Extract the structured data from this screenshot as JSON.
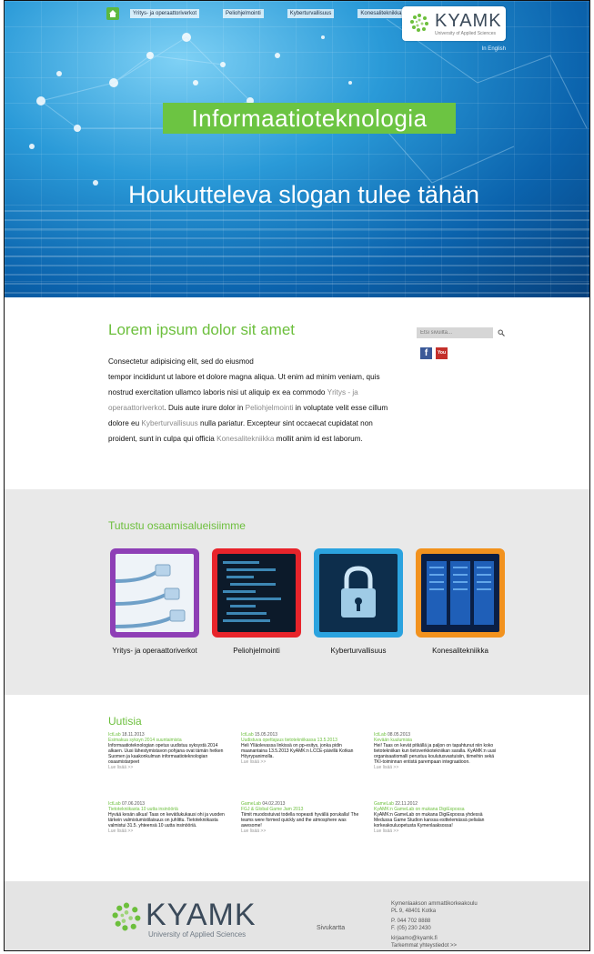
{
  "nav": {
    "home_icon": "home-icon",
    "items": [
      "Yritys- ja operaattoriverkot",
      "Peliohjelmointi",
      "Kyberturvallisuus",
      "Konesaliteknikka"
    ]
  },
  "logo": {
    "name": "KYAMK",
    "subtitle": "University of Applied Sciences"
  },
  "hero": {
    "in_english": "In English",
    "banner": "Informaatioteknologia",
    "slogan": "Houkutteleva slogan tulee tähän"
  },
  "intro": {
    "title": "Lorem ipsum dolor sit amet",
    "p1": "Consectetur adipisicing elit, sed do eiusmod",
    "p2": "tempor incididunt ut labore et dolore magna aliqua. Ut enim ad minim veniam, quis nostrud exercitation ullamco laboris nisi ut aliquip ex ea commodo ",
    "link1": "Yritys - ja operaattoriverkot",
    "p3": ". Duis aute irure dolor in ",
    "link2": "Peliohjelmointi",
    "p4": " in voluptate velit esse cillum dolore eu ",
    "link3": "Kyberturvallisuus",
    "p5": " nulla pariatur. Excepteur sint occaecat cupidatat non proident, sunt in culpa qui officia ",
    "link4": "Konesalitekniikka",
    "p6": " mollit anim id est laborum."
  },
  "sidebar": {
    "search_placeholder": "Etsi sivuilta...",
    "facebook": "f",
    "youtube": "You Tube"
  },
  "areas": {
    "title": "Tutustu osaamisalueisiimme",
    "tiles": [
      {
        "label": "Yritys- ja operaattoriverkot",
        "color": "#8e3fb6"
      },
      {
        "label": "Peliohjelmointi",
        "color": "#e8242b"
      },
      {
        "label": "Kyberturvallisuus",
        "color": "#2ba3df"
      },
      {
        "label": "Konesalitekniikka",
        "color": "#f2921e"
      }
    ]
  },
  "news": {
    "title": "Uutisia",
    "more": "Lue lisää >>",
    "items": [
      {
        "source": "IctLab",
        "date": "18.11.2013",
        "headline": "Esimakua syksyn 2014 suuntaimista",
        "body": "Informaatioteknologian opetus uudistuu syksystä 2014 alkaen. Uusi lähestymistavon pohjana ovat tämän hetken Suomen ja kaakonkulman informaatioteknologian osaamistarpeet"
      },
      {
        "source": "IctLab",
        "date": "15.05.2013",
        "headline": "Uudistuva opettajuus tietotekniikassa 13.5.2013",
        "body": "Heli Ylläolevassa linkissä on pp-esitys, jonka pidin maanantaina 13.5.2013 KyAMK:n LCCE-päivillä Kotkan Höyrypanimolla."
      },
      {
        "source": "IctLab",
        "date": "08.05.2013",
        "headline": "Kevään kuulumisia",
        "body": "Hei! Taas on kevät pitkällä ja paljon on tapahtunut niin koko tietotekniikan kun tietoverkkotekniikan saralla. KyAMK:n uusi organisaatiomalli perustuu koulutusvastuisiin, tiimeihin sekä TKI-toiminnan entistä parempaan integraatioon."
      },
      {
        "source": "IctLab",
        "date": "07.06.2013",
        "headline": "Tietotekniikasta 10 uutta insinööriä",
        "body": "Hyvää kesän alkua! Taas on kevätlukukausi ohi ja vuoden tärkein valmistumistilaisuus on juhlittu. Tietotekniikasta valmistui 31.5. yhteensä 10 uutta insinööriä."
      },
      {
        "source": "GameLab",
        "date": "04.02.2013",
        "headline": "FGJ & Global Game Jam 2013",
        "body": "Tiimit muodostuivat todella nopeasti hyvällä porukalla! The teams were formed quickly and the atmosphere was awesome!"
      },
      {
        "source": "GameLab",
        "date": "22.11.2012",
        "headline": "KyAMK:n GameLab on mukana DigiExpossa",
        "body": "KyAMK:n GameLab on mukana DigiExpossa yhdessä Medussa Game Studion kanssa esittelemässä pelialan korkeakouluopetusta Kymenlaaksossa!"
      }
    ]
  },
  "footer": {
    "sitemap": "Sivukartta",
    "address1": "Kymenlaakson ammattikorkeakoulu",
    "address2": "PL 9, 48401 Kotka",
    "phone": "P. 044 702 8888",
    "fax": "F. (05) 230 2430",
    "email": "kirjaamo@kyamk.fi",
    "contact_link": "Tarkemmat yhteystiedot >>"
  }
}
